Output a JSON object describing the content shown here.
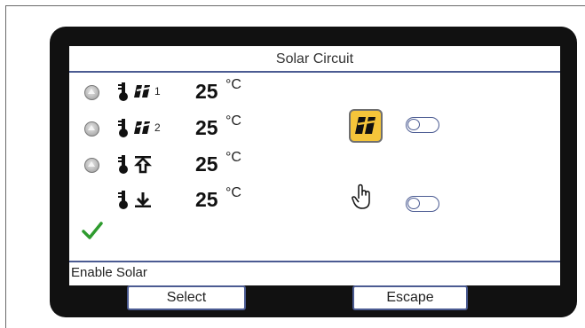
{
  "screen": {
    "title": "Solar Circuit"
  },
  "rows": [
    {
      "sub": "1",
      "value": "25",
      "unit": "°C",
      "symbol": "solar-collector-icon"
    },
    {
      "sub": "2",
      "value": "25",
      "unit": "°C",
      "symbol": "solar-collector-icon"
    },
    {
      "sub": "",
      "value": "25",
      "unit": "°C",
      "symbol": "tank-top-icon"
    },
    {
      "sub": "",
      "value": "25",
      "unit": "°C",
      "symbol": "tank-bottom-icon"
    }
  ],
  "status": {
    "text": "Enable Solar"
  },
  "softkeys": {
    "left": "Select",
    "right": "Escape"
  },
  "colors": {
    "accent": "#4b5b92",
    "solar_yellow": "#f5c53a",
    "check_green": "#2e9b2e",
    "bezel": "#111111"
  }
}
